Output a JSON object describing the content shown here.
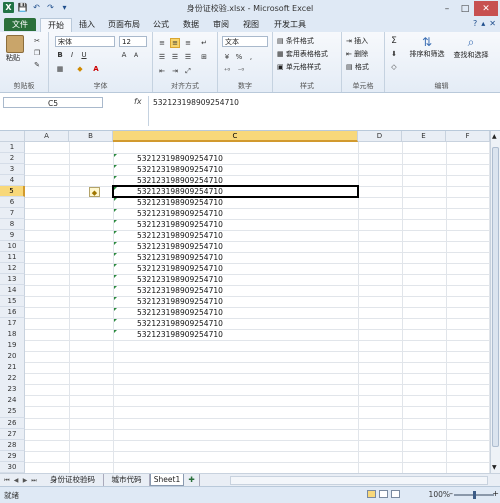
{
  "window": {
    "title": "身份证校验.xlsx - Microsoft Excel",
    "minimize": "–",
    "maximize": "□",
    "close": "✕"
  },
  "qat": {
    "app_icon": "X",
    "save": "💾",
    "undo": "↶",
    "redo": "↷",
    "dropdown": "▾"
  },
  "tabs": [
    "文件",
    "开始",
    "插入",
    "页面布局",
    "公式",
    "数据",
    "审阅",
    "视图",
    "开发工具"
  ],
  "active_tab": "开始",
  "tabs_right": {
    "help": "?",
    "minimize_ribbon": "▴",
    "close_book": "✕"
  },
  "ribbon": {
    "clipboard": {
      "label": "剪贴板",
      "paste": "粘贴"
    },
    "font": {
      "label": "字体",
      "name": "宋体",
      "size": "12",
      "bold": "B",
      "italic": "I",
      "underline": "U",
      "grow": "A",
      "shrink": "A"
    },
    "alignment": {
      "label": "对齐方式"
    },
    "number": {
      "label": "数字",
      "format": "文本",
      "percent": "%",
      "comma": ",",
      "currency": "¥"
    },
    "styles": {
      "label": "样式",
      "conditional": "条件格式",
      "table": "套用表格格式",
      "cell_styles": "单元格样式"
    },
    "cells": {
      "label": "单元格",
      "insert": "插入",
      "delete": "删除",
      "format": "格式"
    },
    "editing": {
      "label": "编辑",
      "sum": "Σ",
      "sort": "排序和筛选",
      "find": "查找和选择"
    }
  },
  "formula_bar": {
    "name_box": "C5",
    "fx": "fx",
    "content": "532123198909254710"
  },
  "columns": [
    "A",
    "B",
    "C",
    "D",
    "E",
    "F"
  ],
  "selected_column": "C",
  "rows": [
    "1",
    "2",
    "3",
    "4",
    "5",
    "6",
    "7",
    "8",
    "9",
    "10",
    "11",
    "12",
    "13",
    "14",
    "15",
    "16",
    "17",
    "18",
    "19",
    "20",
    "21",
    "22",
    "23",
    "24",
    "25",
    "26",
    "27",
    "28",
    "29",
    "30"
  ],
  "selected_row": "5",
  "active_cell": "C5",
  "cell_values": [
    "532123198909254710",
    "532123198909254710",
    "532123198909254710",
    "532123198909254710",
    "532123198909254710",
    "532123198909254710",
    "532123198909254710",
    "532123198909254710",
    "532123198909254710",
    "532123198909254710",
    "532123198909254710",
    "532123198909254710",
    "532123198909254710",
    "532123198909254710",
    "532123198909254710",
    "532123198909254710",
    "532123198909254710"
  ],
  "error_indicator": "◆",
  "sheet_nav": [
    "⏮",
    "◀",
    "▶",
    "⏭"
  ],
  "sheets": [
    "身份证校验码",
    "城市代码",
    "Sheet1"
  ],
  "active_sheet": "Sheet1",
  "new_sheet": "✚",
  "status": {
    "mode": "就绪",
    "zoom": "100%",
    "zoom_out": "–",
    "zoom_in": "+"
  }
}
